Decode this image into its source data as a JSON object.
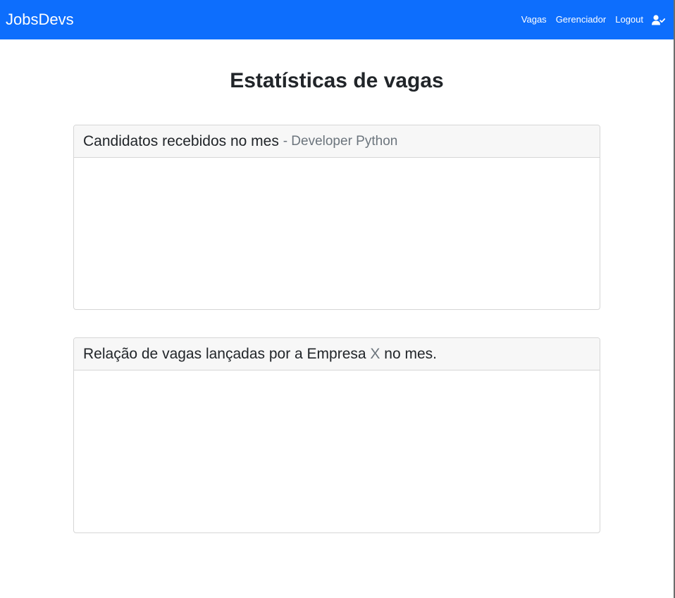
{
  "navbar": {
    "brand": "JobsDevs",
    "links": [
      "Vagas",
      "Gerenciador",
      "Logout"
    ],
    "user_icon": "user-check-icon",
    "bg_color": "#0d6efd"
  },
  "main": {
    "title": "Estatísticas de vagas",
    "cards": [
      {
        "title": "Candidatos recebidos no mes",
        "subtitle": "- Developer Python"
      },
      {
        "title_prefix": "Relação de vagas lançadas por a Empresa",
        "company": "X",
        "title_suffix": "no mes."
      }
    ]
  }
}
